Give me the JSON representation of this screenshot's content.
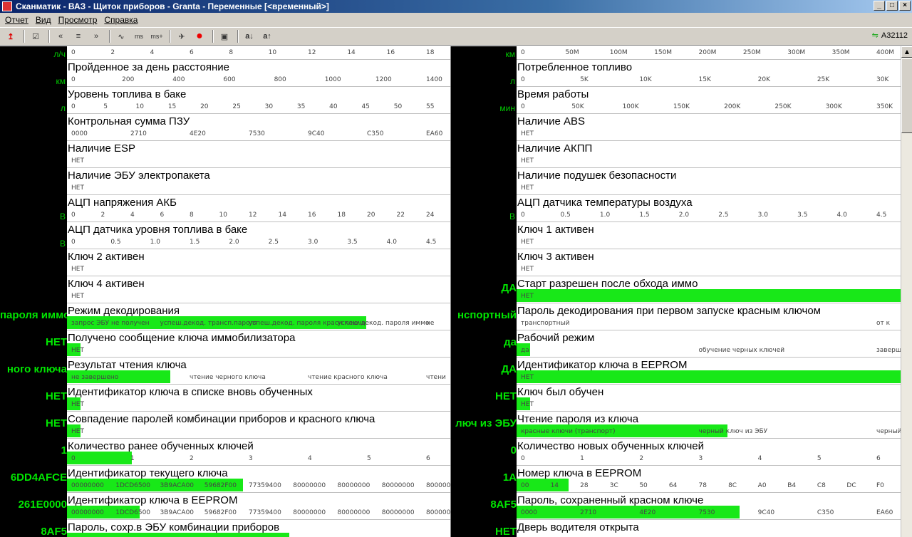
{
  "window": {
    "title": "Сканматик - ВАЗ - Щиток приборов - Granta - Переменные [<временный>]"
  },
  "menu": [
    "Отчет",
    "Вид",
    "Просмотр",
    "Справка"
  ],
  "toolbar": {
    "device": "A32112"
  },
  "left": [
    {
      "value": "",
      "unit": "л/ч",
      "name": "",
      "bar": 0,
      "ticks": [
        "0",
        "2",
        "4",
        "6",
        "8",
        "10",
        "12",
        "14",
        "16",
        "18"
      ]
    },
    {
      "value": "",
      "unit": "км",
      "name": "Пройденное за день расстояние",
      "bar": 0,
      "ticks": [
        "0",
        "200",
        "400",
        "600",
        "800",
        "1000",
        "1200",
        "1400"
      ]
    },
    {
      "value": "",
      "unit": "л",
      "name": "Уровень топлива в баке",
      "bar": 0,
      "ticks": [
        "0",
        "5",
        "10",
        "15",
        "20",
        "25",
        "30",
        "35",
        "40",
        "45",
        "50",
        "55"
      ]
    },
    {
      "value": "",
      "unit": "",
      "name": "Контрольная сумма ПЗУ",
      "bar": 0,
      "ticks": [
        "0000",
        "2710",
        "4E20",
        "7530",
        "9C40",
        "C350",
        "EA60"
      ]
    },
    {
      "value": "",
      "unit": "",
      "name": "Наличие ESP",
      "bar": 0,
      "ticks": [
        "НЕТ"
      ]
    },
    {
      "value": "",
      "unit": "",
      "name": "Наличие ЭБУ электропакета",
      "bar": 0,
      "ticks": [
        "НЕТ"
      ]
    },
    {
      "value": "",
      "unit": "В",
      "name": "АЦП напряжения АКБ",
      "bar": 0,
      "ticks": [
        "0",
        "2",
        "4",
        "6",
        "8",
        "10",
        "12",
        "14",
        "16",
        "18",
        "20",
        "22",
        "24"
      ]
    },
    {
      "value": "",
      "unit": "В",
      "name": "АЦП датчика уровня топлива в баке",
      "bar": 0,
      "ticks": [
        "0",
        "0.5",
        "1.0",
        "1.5",
        "2.0",
        "2.5",
        "3.0",
        "3.5",
        "4.0",
        "4.5"
      ]
    },
    {
      "value": "",
      "unit": "",
      "name": "Ключ 2 активен",
      "bar": 0,
      "ticks": [
        "НЕТ"
      ]
    },
    {
      "value": "",
      "unit": "",
      "name": "Ключ 4 активен",
      "bar": 0,
      "ticks": [
        "НЕТ"
      ]
    },
    {
      "value": "пароля иммо",
      "unit": "",
      "name": "Режим декодирования",
      "bar": 0.78,
      "ticks": [
        "запрос ЭБУ не получен",
        "успеш.декод. трансп.пароля",
        "успеш.декод. пароля красн.ключа",
        "успеш.декод. пароля иммо",
        "не"
      ]
    },
    {
      "value": "НЕТ",
      "unit": "",
      "name": "Получено сообщение ключа иммобилизатора",
      "bar": 0.035,
      "ticks": [
        "НЕТ"
      ]
    },
    {
      "value": "ного ключа",
      "unit": "",
      "name": "Результат чтения ключа",
      "bar": 0.27,
      "ticks": [
        "не завершено",
        "чтение черного ключа",
        "чтение красного ключа",
        "чтени"
      ]
    },
    {
      "value": "НЕТ",
      "unit": "",
      "name": "Идентификатор ключа в списке вновь обученных",
      "bar": 0.035,
      "ticks": [
        "НЕТ"
      ]
    },
    {
      "value": "НЕТ",
      "unit": "",
      "name": "Совпадение паролей комбинации приборов и красного ключа",
      "bar": 0.035,
      "ticks": [
        "НЕТ"
      ]
    },
    {
      "value": "1",
      "unit": "",
      "name": "Количество ранее обученных ключей",
      "bar": 0.17,
      "ticks": [
        "0",
        "1",
        "2",
        "3",
        "4",
        "5",
        "6"
      ]
    },
    {
      "value": "6DD4AFCE",
      "unit": "",
      "name": "Идентификатор текущего ключа",
      "bar": 0.46,
      "ticks": [
        "00000000",
        "1DCD6500",
        "3B9ACA00",
        "59682F00",
        "77359400",
        "80000000",
        "80000000",
        "80000000",
        "8000000"
      ]
    },
    {
      "value": "261E0000",
      "unit": "",
      "name": "Идентификатор ключа в EEPROM",
      "bar": 0.19,
      "ticks": [
        "00000000",
        "1DCD6500",
        "3B9ACA00",
        "59682F00",
        "77359400",
        "80000000",
        "80000000",
        "80000000",
        "8000000"
      ]
    },
    {
      "value": "8AF5",
      "unit": "",
      "name": "Пароль, сохр.в ЭБУ комбинации приборов",
      "bar": 0.58,
      "ticks": []
    }
  ],
  "right": [
    {
      "value": "",
      "unit": "км",
      "name": "",
      "bar": 0,
      "ticks": [
        "0",
        "50M",
        "100M",
        "150M",
        "200M",
        "250M",
        "300M",
        "350M",
        "400M"
      ]
    },
    {
      "value": "",
      "unit": "л",
      "name": "Потребленное топливо",
      "bar": 0,
      "ticks": [
        "0",
        "5K",
        "10K",
        "15K",
        "20K",
        "25K",
        "30K"
      ]
    },
    {
      "value": "",
      "unit": "мин",
      "name": "Время работы",
      "bar": 0,
      "ticks": [
        "0",
        "50K",
        "100K",
        "150K",
        "200K",
        "250K",
        "300K",
        "350K"
      ]
    },
    {
      "value": "",
      "unit": "",
      "name": "Наличие ABS",
      "bar": 0,
      "ticks": [
        "НЕТ"
      ]
    },
    {
      "value": "",
      "unit": "",
      "name": "Наличие АКПП",
      "bar": 0,
      "ticks": [
        "НЕТ"
      ]
    },
    {
      "value": "",
      "unit": "",
      "name": "Наличие подушек безопасности",
      "bar": 0,
      "ticks": [
        "НЕТ"
      ]
    },
    {
      "value": "",
      "unit": "В",
      "name": "АЦП датчика температуры воздуха",
      "bar": 0,
      "ticks": [
        "0",
        "0.5",
        "1.0",
        "1.5",
        "2.0",
        "2.5",
        "3.0",
        "3.5",
        "4.0",
        "4.5"
      ]
    },
    {
      "value": "",
      "unit": "",
      "name": "Ключ 1 активен",
      "bar": 0,
      "ticks": [
        "НЕТ"
      ]
    },
    {
      "value": "",
      "unit": "",
      "name": "Ключ 3 активен",
      "bar": 0,
      "ticks": [
        "НЕТ"
      ]
    },
    {
      "value": "ДА",
      "unit": "",
      "name": "Старт разрешен после обхода иммо",
      "bar": 1.0,
      "ticks": [
        "НЕТ"
      ]
    },
    {
      "value": "нспортный",
      "unit": "",
      "name": "Пароль декодирования при первом запуске красным ключом",
      "bar": 0,
      "ticks": [
        "транспортный",
        "от к"
      ]
    },
    {
      "value": "да",
      "unit": "",
      "name": "Рабочий режим",
      "bar": 0.035,
      "ticks": [
        "да",
        "обучение черных ключей",
        "заверш"
      ]
    },
    {
      "value": "ДА",
      "unit": "",
      "name": "Идентификатор ключа в EEPROM",
      "bar": 1.0,
      "ticks": [
        "НЕТ"
      ]
    },
    {
      "value": "НЕТ",
      "unit": "",
      "name": "Ключ был обучен",
      "bar": 0.035,
      "ticks": [
        "НЕТ"
      ]
    },
    {
      "value": "люч из ЭБУ",
      "unit": "",
      "name": "Чтение пароля из ключа",
      "bar": 0.55,
      "ticks": [
        "красные ключи (транспорт)",
        "черный ключ из ЭБУ",
        "черный к"
      ]
    },
    {
      "value": "0",
      "unit": "",
      "name": "Количество новых обученных ключей",
      "bar": 0,
      "ticks": [
        "0",
        "1",
        "2",
        "3",
        "4",
        "5",
        "6"
      ]
    },
    {
      "value": "1A",
      "unit": "",
      "name": "Номер ключа в EEPROM",
      "bar": 0.135,
      "ticks": [
        "00",
        "14",
        "28",
        "3C",
        "50",
        "64",
        "78",
        "8C",
        "A0",
        "B4",
        "C8",
        "DC",
        "F0"
      ]
    },
    {
      "value": "8AF5",
      "unit": "",
      "name": "Пароль, сохраненный красном ключе",
      "bar": 0.58,
      "ticks": [
        "0000",
        "2710",
        "4E20",
        "7530",
        "9C40",
        "C350",
        "EA60"
      ]
    },
    {
      "value": "НЕТ",
      "unit": "",
      "name": "Дверь водителя открыта",
      "bar": 0,
      "ticks": []
    }
  ]
}
